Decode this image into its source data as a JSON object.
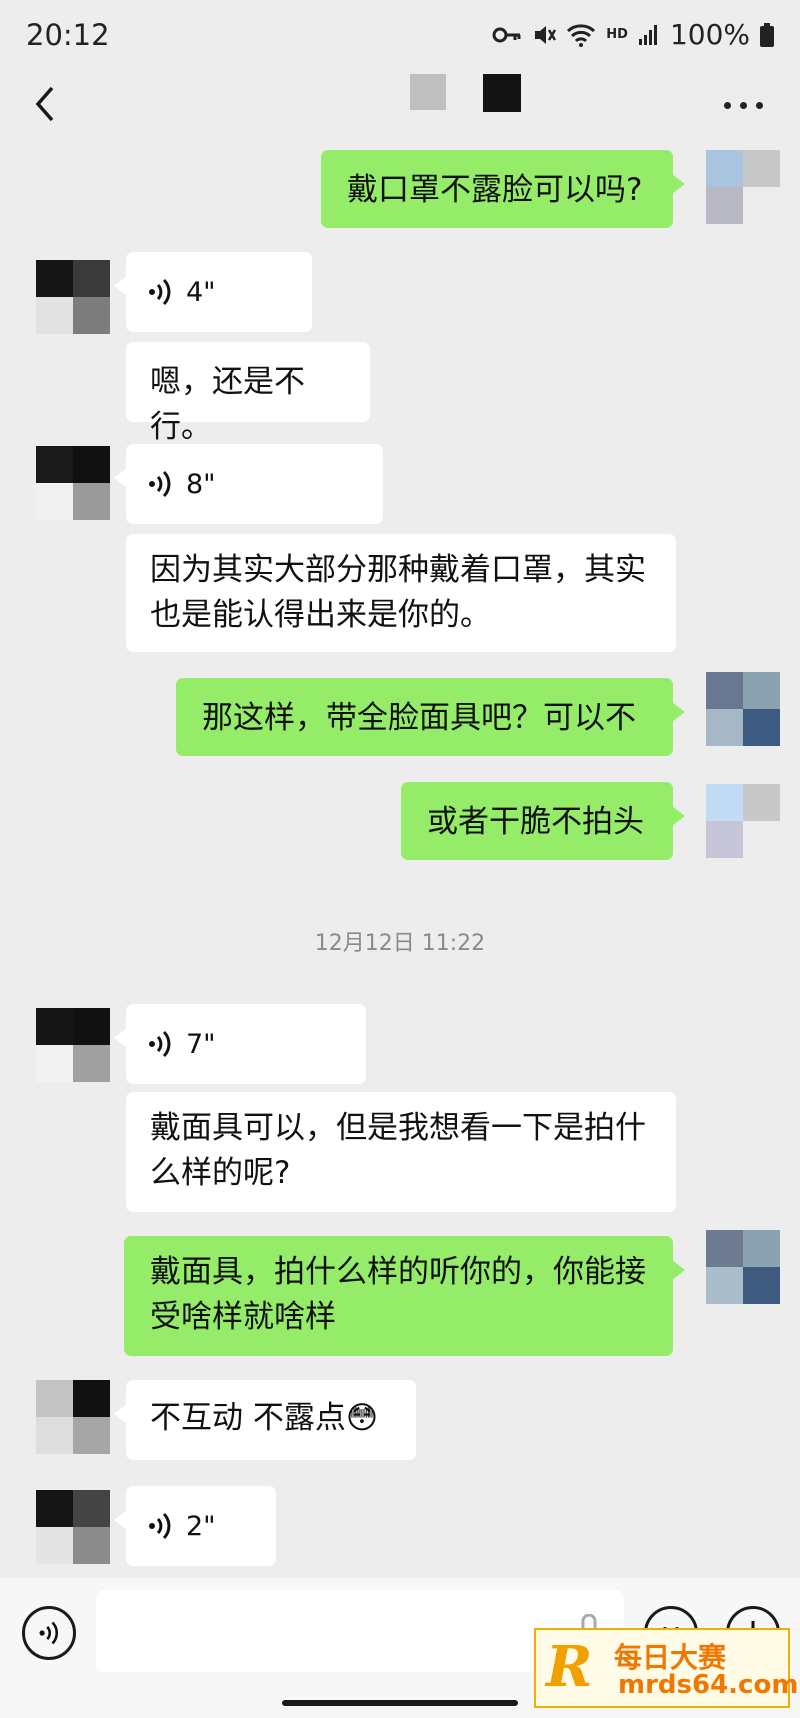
{
  "status_bar": {
    "time": "20:12",
    "hd": "HD",
    "battery": "100%"
  },
  "timestamp": "12月12日 11:22",
  "messages": {
    "m1": "戴口罩不露脸可以吗?",
    "m2": "4\"",
    "m3": "嗯，还是不行。",
    "m4": "8\"",
    "m5a": "因为其实大部分那种戴着口罩，其实",
    "m5b": "也是能认得出来是你的。",
    "m6": "那这样，带全脸面具吧？可以不",
    "m7": "或者干脆不拍头",
    "m8": "7\"",
    "m9a": "戴面具可以，但是我想看一下是拍什",
    "m9b": "么样的呢?",
    "m10a": "戴面具，拍什么样的听你的，你能接",
    "m10b": "受啥样就啥样",
    "m11": "不互动 不露点😳",
    "m12": "2\""
  },
  "watermark": {
    "logo": "R",
    "cn": "每日大赛",
    "en": "mrds64.com"
  },
  "icons": [
    "key-icon",
    "mute-icon",
    "wifi-icon",
    "signal-icon",
    "battery-icon",
    "back-icon",
    "more-icon",
    "voice-icon",
    "mic-icon",
    "emoji-icon",
    "plus-icon"
  ],
  "colors": {
    "outgoing": "#95ec69",
    "incoming": "#ffffff",
    "background": "#ededed"
  }
}
